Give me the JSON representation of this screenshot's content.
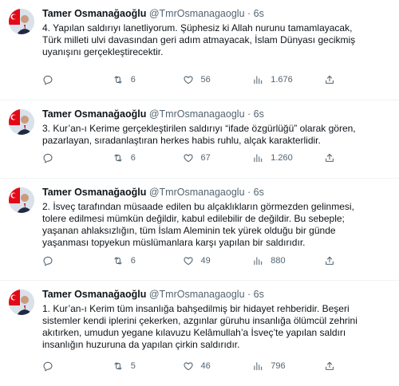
{
  "author": {
    "name": "Tamer Osmanağaoğlu",
    "handle": "@TmrOsmanagaoglu",
    "separator": "·"
  },
  "colors": {
    "icon": "#536471",
    "text": "#0f1419",
    "divider": "#eff3f4",
    "flag_red": "#e30a17"
  },
  "tweets": [
    {
      "time": "6s",
      "text": "4. Yapılan saldırıyı lanetliyorum. Şüphesiz ki Allah nurunu tamamlayacak,\nTürk milleti ulvi davasından geri adım atmayacak, İslam Dünyası gecikmiş\nuyanışını gerçekleştirecektir.",
      "replies": "",
      "retweets": "6",
      "likes": "56",
      "views": "1.676"
    },
    {
      "time": "6s",
      "text": "3. Kur’an-ı Kerime gerçekleştirilen saldırıyı “ifade özgürlüğü” olarak gören,\npazarlayan, sıradanlaştıran herkes habis ruhlu, alçak karakterlidir.",
      "replies": "",
      "retweets": "6",
      "likes": "67",
      "views": "1.260"
    },
    {
      "time": "6s",
      "text": "2. İsveç tarafından müsaade edilen bu alçaklıkların görmezden gelinmesi,\ntolere edilmesi mümkün değildir, kabul edilebilir de değildir. Bu sebeple;\nyaşanan ahlaksızlığın, tüm İslam Aleminin tek yürek olduğu bir günde\nyaşanması topyekun müslümanlara karşı yapılan bir saldırıdır.",
      "replies": "",
      "retweets": "6",
      "likes": "49",
      "views": "880"
    },
    {
      "time": "6s",
      "text": "1. Kur’an-ı Kerim tüm insanlığa bahşedilmiş bir hidayet rehberidir. Beşeri\nsistemler kendi iplerini çekerken, azgınlar güruhu insanlığa ölümcül zehrini\nakıtırken, umudun yegane kılavuzu Kelâmullah’a İsveç’te yapılan saldırı\ninsanlığın huzuruna da yapılan çirkin saldırıdır.",
      "replies": "",
      "retweets": "5",
      "likes": "46",
      "views": "796"
    }
  ]
}
